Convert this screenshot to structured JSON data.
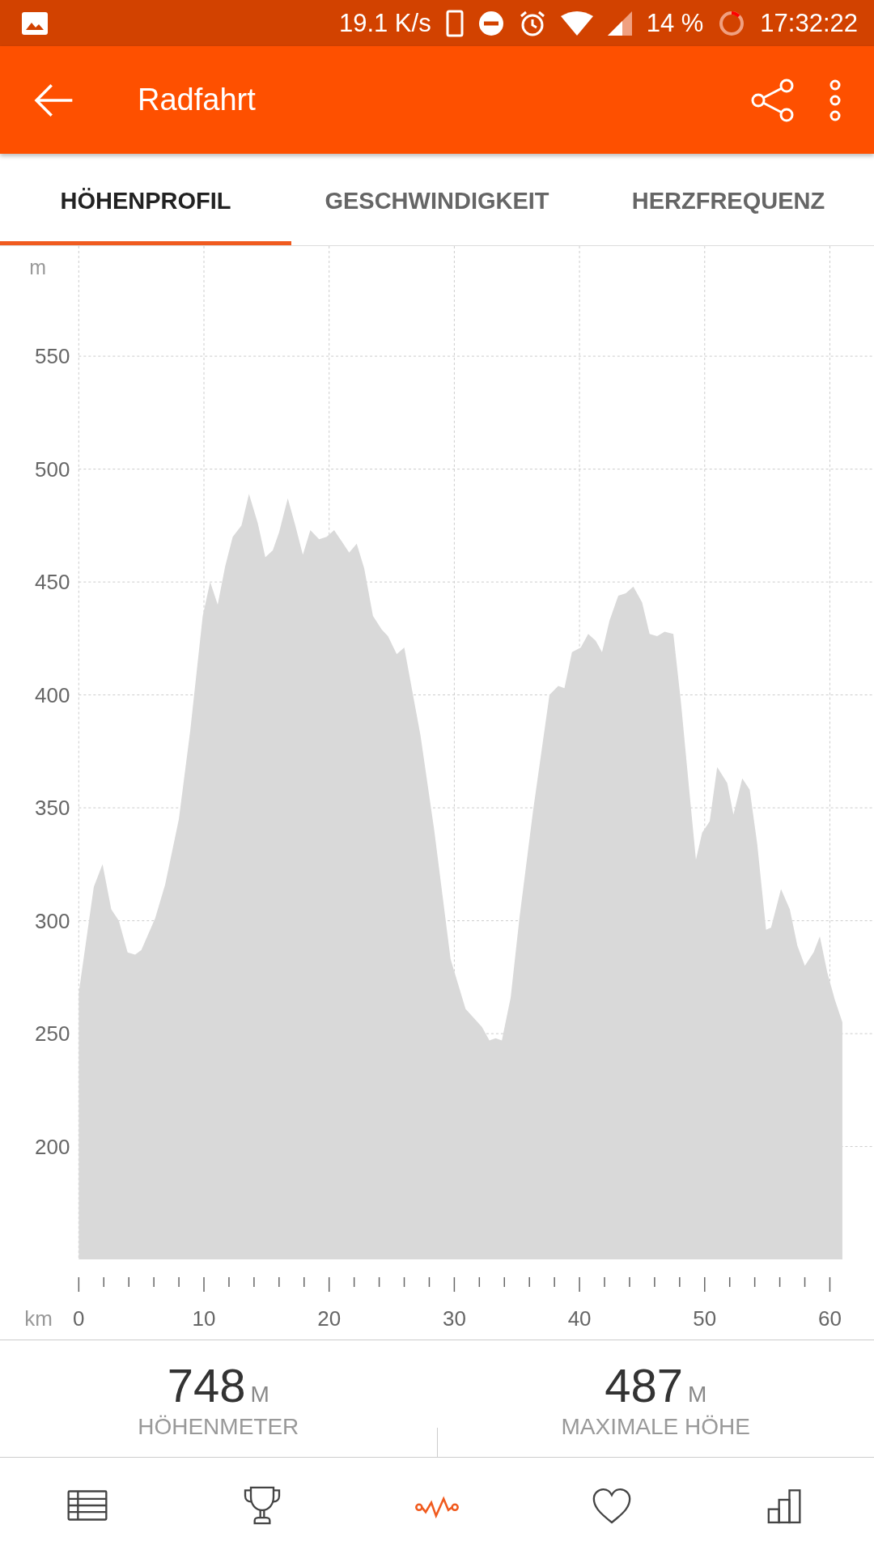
{
  "status_bar": {
    "speed": "19.1 K/s",
    "battery": "14 %",
    "time": "17:32:22"
  },
  "app_bar": {
    "title": "Radfahrt"
  },
  "tabs": [
    {
      "label": "HÖHENPROFIL",
      "selected": true
    },
    {
      "label": "GESCHWINDIGKEIT",
      "selected": false
    },
    {
      "label": "HERZFREQUENZ",
      "selected": false
    }
  ],
  "chart": {
    "y_unit": "m",
    "x_unit": "km",
    "chart_data": {
      "type": "area",
      "xlim": [
        0,
        63.5
      ],
      "ylim": [
        150,
        599
      ],
      "grid": true,
      "xticks": [
        0,
        10,
        20,
        30,
        40,
        50,
        60
      ],
      "yticks": [
        200,
        250,
        300,
        350,
        400,
        450,
        500,
        550
      ],
      "x": [
        0,
        1.2,
        1.9,
        2.6,
        3.2,
        3.9,
        4.5,
        5.0,
        6.1,
        6.9,
        8.0,
        8.9,
        9.9,
        10.5,
        11.1,
        11.7,
        12.3,
        13.0,
        13.6,
        14.3,
        14.9,
        15.5,
        16.0,
        16.7,
        17.3,
        17.9,
        18.5,
        19.2,
        19.8,
        20.4,
        21.0,
        21.6,
        22.2,
        22.8,
        23.5,
        24.2,
        24.7,
        25.4,
        26.0,
        27.3,
        28.4,
        29.7,
        30.9,
        32.2,
        32.8,
        33.3,
        33.8,
        34.5,
        35.2,
        36.3,
        37.6,
        38.3,
        38.8,
        39.4,
        40.1,
        40.7,
        41.3,
        41.8,
        42.4,
        43.1,
        43.7,
        44.3,
        45.0,
        45.6,
        46.2,
        46.8,
        47.5,
        48.1,
        48.8,
        49.3,
        49.8,
        50.4,
        51.0,
        51.8,
        52.3,
        53.0,
        53.6,
        54.2,
        54.9,
        55.3,
        56.1,
        56.8,
        57.4,
        58.0,
        58.7,
        59.2,
        59.8,
        60.4,
        61.0
      ],
      "series": [
        {
          "color": "#d9d9d9",
          "values": [
            268,
            315,
            325,
            305,
            300,
            286,
            285,
            287,
            301,
            316,
            345,
            384,
            435,
            450,
            440,
            457,
            470,
            475,
            489,
            476,
            461,
            464,
            472,
            487,
            475,
            462,
            473,
            469,
            470,
            473,
            468,
            463,
            467,
            456,
            435,
            429,
            426,
            418,
            421,
            382,
            340,
            283,
            261,
            253,
            247,
            248,
            247,
            266,
            301,
            349,
            400,
            404,
            403,
            419,
            421,
            427,
            424,
            419,
            433,
            444,
            445,
            448,
            441,
            427,
            426,
            428,
            427,
            397,
            356,
            327,
            339,
            344,
            368,
            361,
            347,
            363,
            358,
            334,
            296,
            297,
            314,
            305,
            289,
            280,
            286,
            293,
            277,
            265,
            255
          ]
        }
      ]
    }
  },
  "stats": [
    {
      "value": "748",
      "unit": "M",
      "label": "HÖHENMETER"
    },
    {
      "value": "487",
      "unit": "M",
      "label": "MAXIMALE HÖHE"
    }
  ],
  "bottom_nav": [
    {
      "kind": "table",
      "selected": false
    },
    {
      "kind": "trophy",
      "selected": false
    },
    {
      "kind": "activity",
      "selected": true
    },
    {
      "kind": "heart",
      "selected": false
    },
    {
      "kind": "bars",
      "selected": false
    }
  ]
}
